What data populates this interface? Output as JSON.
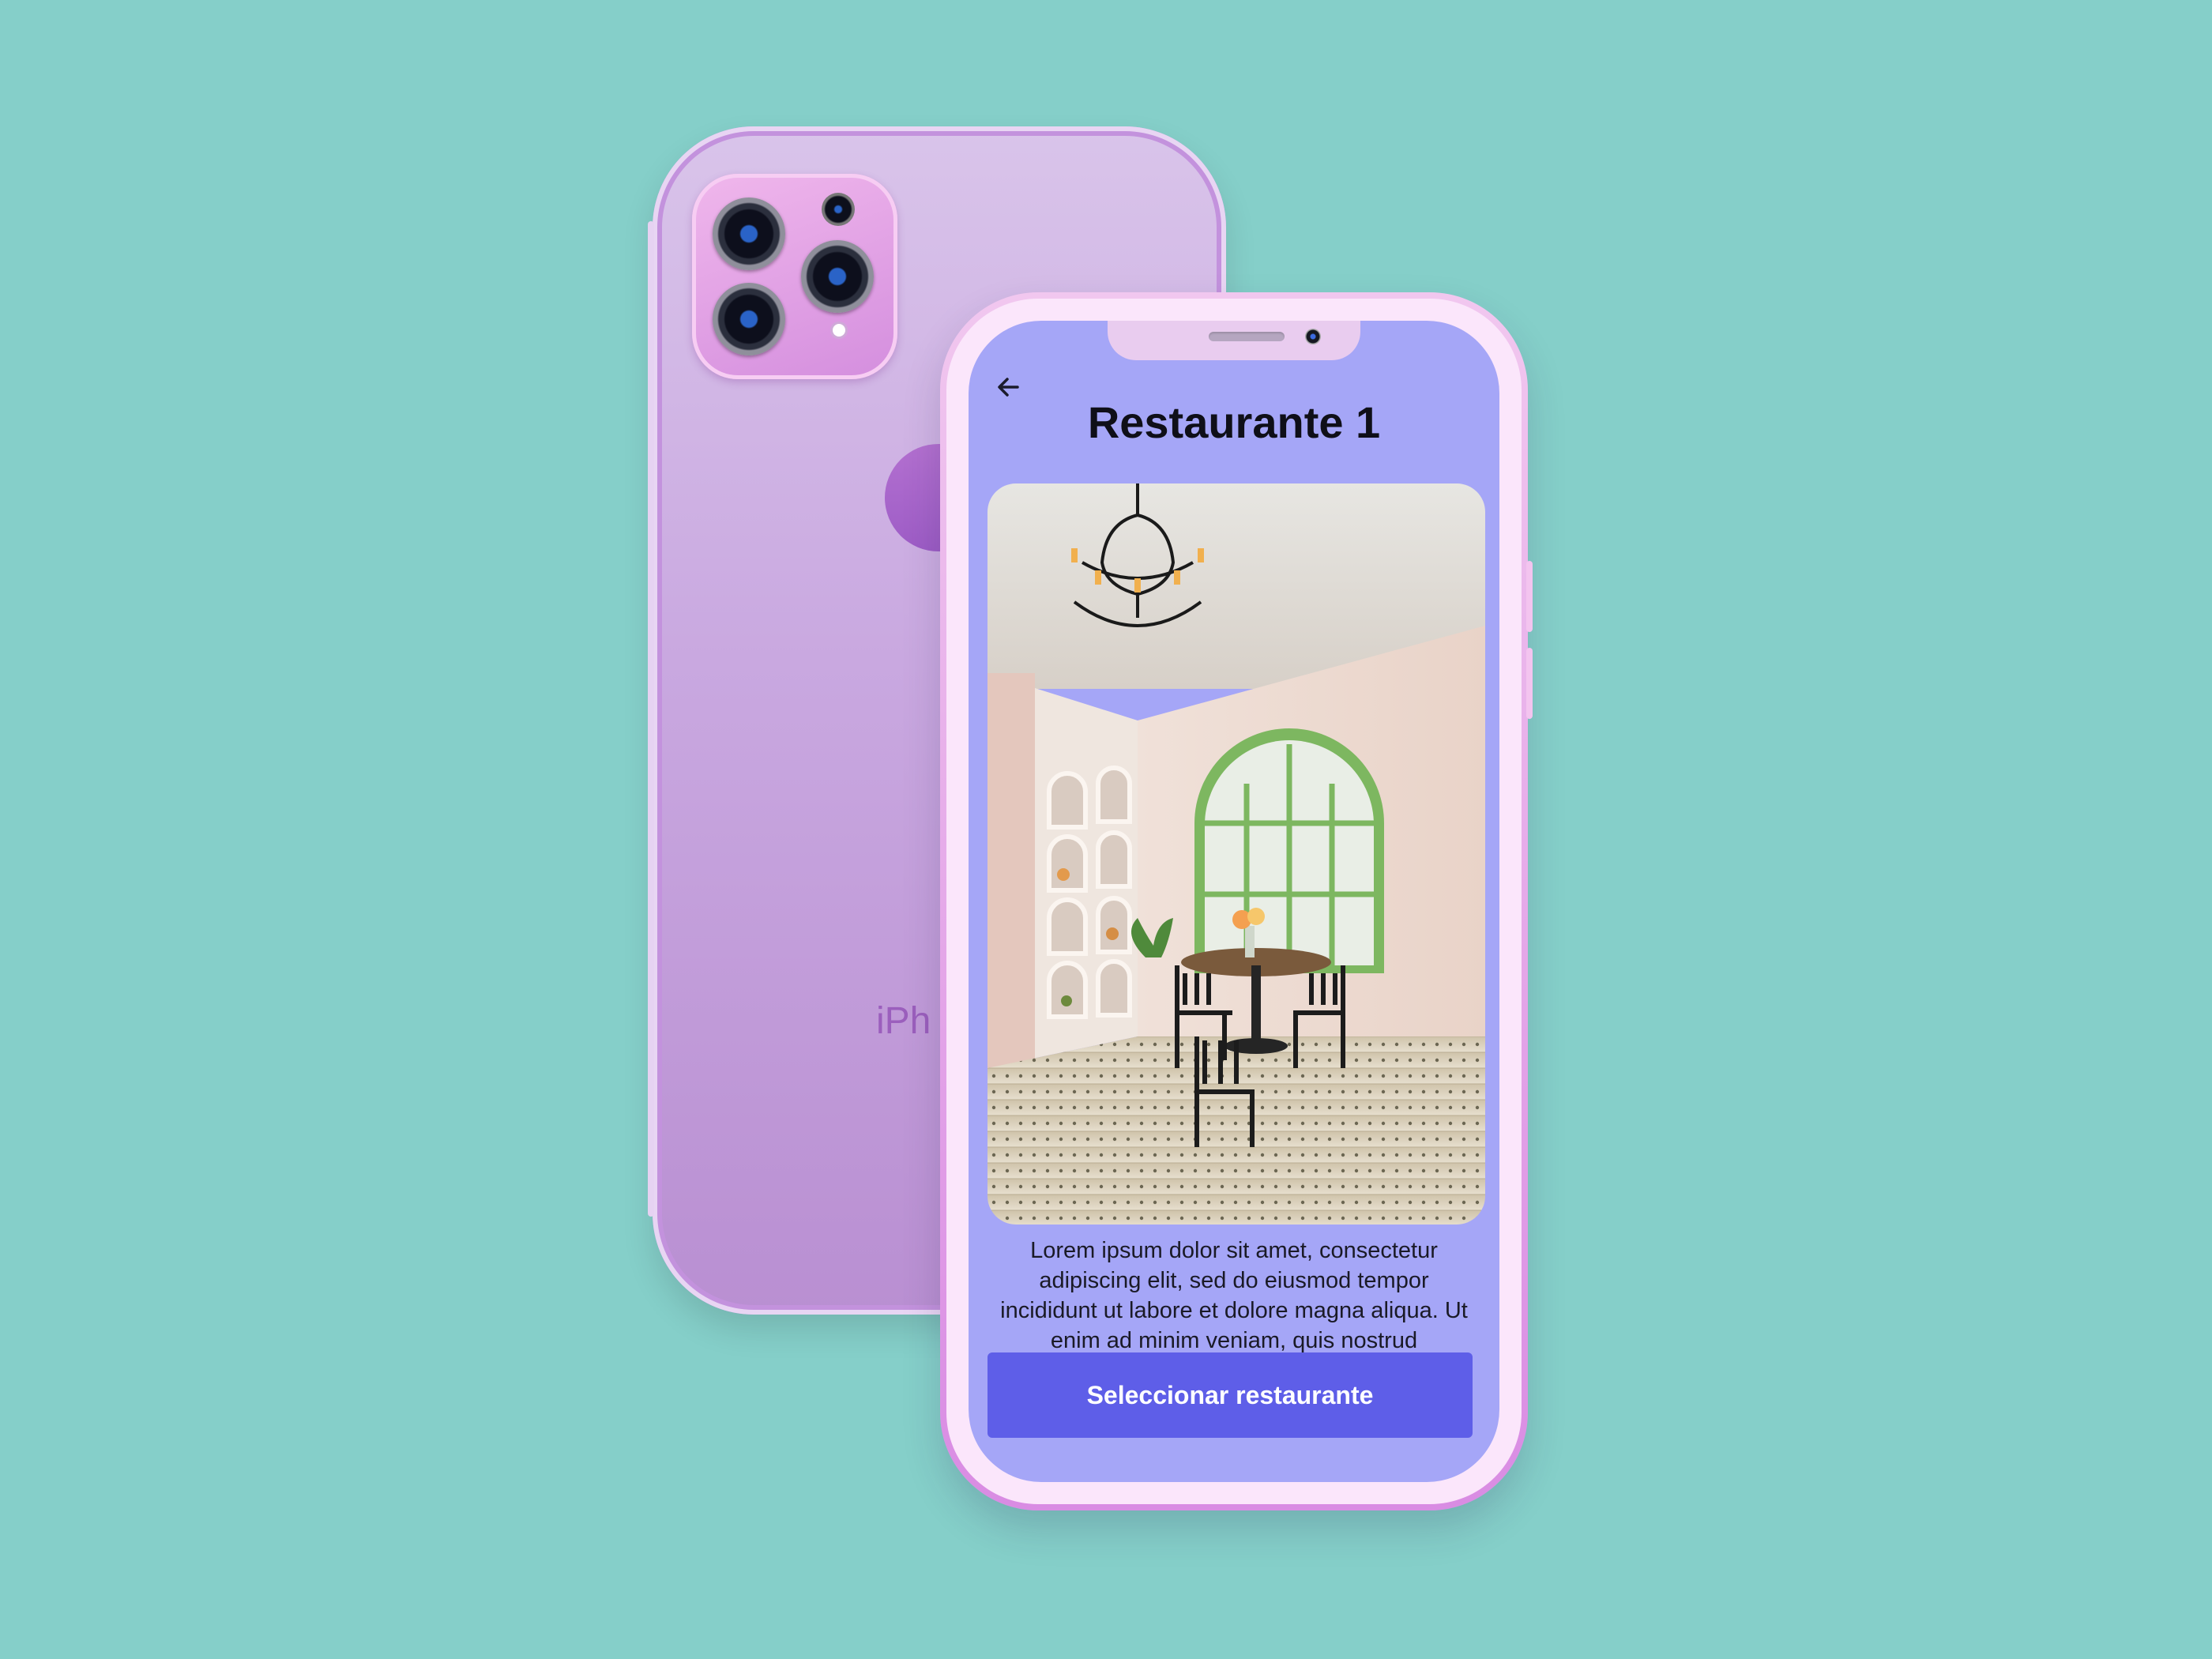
{
  "background_color": "#85cfc9",
  "back_phone": {
    "color": "#c9a8e0",
    "brand_text": "iPh"
  },
  "front_phone": {
    "screen_color": "#a5a6f7",
    "back_button_icon": "arrow-left-icon",
    "title": "Restaurante 1",
    "photo_description_icon": "restaurant-interior-photo",
    "description": "Lorem ipsum dolor sit amet, consectetur adipiscing elit, sed do eiusmod tempor incididunt ut labore et dolore magna aliqua. Ut enim ad minim veniam, quis nostrud",
    "select_button_label": "Seleccionar restaurante",
    "select_button_color": "#5e5ee8"
  }
}
